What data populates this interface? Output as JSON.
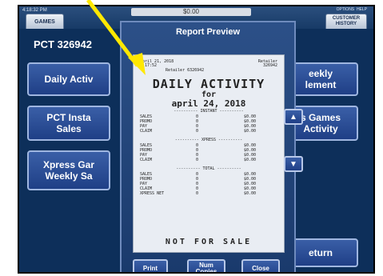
{
  "screen": {
    "status_time": "4:18:32 PM",
    "balance": "$0.00",
    "tabs": {
      "games": "GAMES",
      "customer": "CUSTOMER HISTORY"
    },
    "top_right": [
      "OPTIONS",
      "HELP"
    ],
    "title": "PCT 326942",
    "buttons": {
      "daily_activity": "Daily Activ",
      "pct_instant_sales": "PCT Insta\nSales",
      "xpress_games_weekly": "Xpress Gar\nWeekly Sa",
      "weekly_settlement": "eekly\nlement",
      "xpress_games_activity": "s Games\nActivity",
      "return": "eturn"
    }
  },
  "modal": {
    "title": "Report Preview",
    "receipt": {
      "header_left": "april 21, 2018\n4:17:52",
      "header_right": "Retailer\n326942",
      "retailer_line": "Retailer 6326942",
      "heading": "DAILY ACTIVITY",
      "for_label": "for",
      "date": "april 24, 2018",
      "sections": [
        {
          "name": "INSTANT",
          "rows": [
            [
              "SALES",
              "0",
              "$0.00"
            ],
            [
              "PROMO",
              "0",
              "$0.00"
            ],
            [
              "PAY",
              "0",
              "$0.00"
            ],
            [
              "CLAIM",
              "0",
              "$0.00"
            ]
          ]
        },
        {
          "name": "XPRESS",
          "rows": [
            [
              "SALES",
              "0",
              "$0.00"
            ],
            [
              "PROMO",
              "0",
              "$0.00"
            ],
            [
              "PAY",
              "0",
              "$0.00"
            ],
            [
              "CLAIM",
              "0",
              "$0.00"
            ]
          ]
        },
        {
          "name": "TOTAL",
          "rows": [
            [
              "SALES",
              "0",
              "$0.00"
            ],
            [
              "PROMO",
              "0",
              "$0.00"
            ],
            [
              "PAY",
              "0",
              "$0.00"
            ],
            [
              "CLAIM",
              "0",
              "$0.00"
            ],
            [
              "XPRESS NET",
              "0",
              "$0.00"
            ]
          ]
        }
      ],
      "footer": "NOT FOR SALE"
    },
    "scroll_up": "▲",
    "scroll_down": "▼",
    "footer_buttons": {
      "print": "Print",
      "num_copies": "Num\nCopies",
      "close": "Close"
    }
  },
  "colors": {
    "pointer_arrow": "#ffe800",
    "panel": "#0d2f5a",
    "button": "#2a4f97"
  }
}
